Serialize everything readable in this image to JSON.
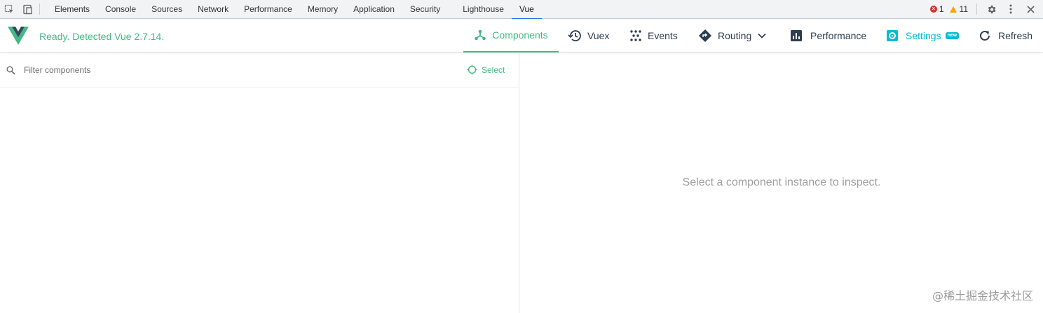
{
  "devtools": {
    "tabs": [
      {
        "label": "Elements"
      },
      {
        "label": "Console"
      },
      {
        "label": "Sources"
      },
      {
        "label": "Network"
      },
      {
        "label": "Performance"
      },
      {
        "label": "Memory"
      },
      {
        "label": "Application"
      },
      {
        "label": "Security"
      },
      {
        "label": "Lighthouse"
      },
      {
        "label": "Vue"
      }
    ],
    "active_tab": "Vue",
    "error_count": "1",
    "warning_count": "11",
    "icons": [
      "inspect-element-icon",
      "device-toolbar-icon",
      "error-icon",
      "warning-icon",
      "gear-icon",
      "more-vertical-icon",
      "close-icon"
    ]
  },
  "vue_header": {
    "status": "Ready. Detected Vue 2.7.14.",
    "nav": {
      "components": "Components",
      "vuex": "Vuex",
      "events": "Events",
      "routing": "Routing",
      "performance": "Performance",
      "settings": "Settings",
      "settings_badge": "new",
      "refresh": "Refresh"
    },
    "active_nav": "Components",
    "colors": {
      "accent": "#42b983",
      "settings": "#00bcd4",
      "dark": "#2c3e50"
    }
  },
  "components_pane": {
    "filter_placeholder": "Filter components",
    "filter_value": "",
    "select_label": "Select"
  },
  "inspector_pane": {
    "empty_message": "Select a component instance to inspect."
  },
  "watermark": "@稀土掘金技术社区"
}
